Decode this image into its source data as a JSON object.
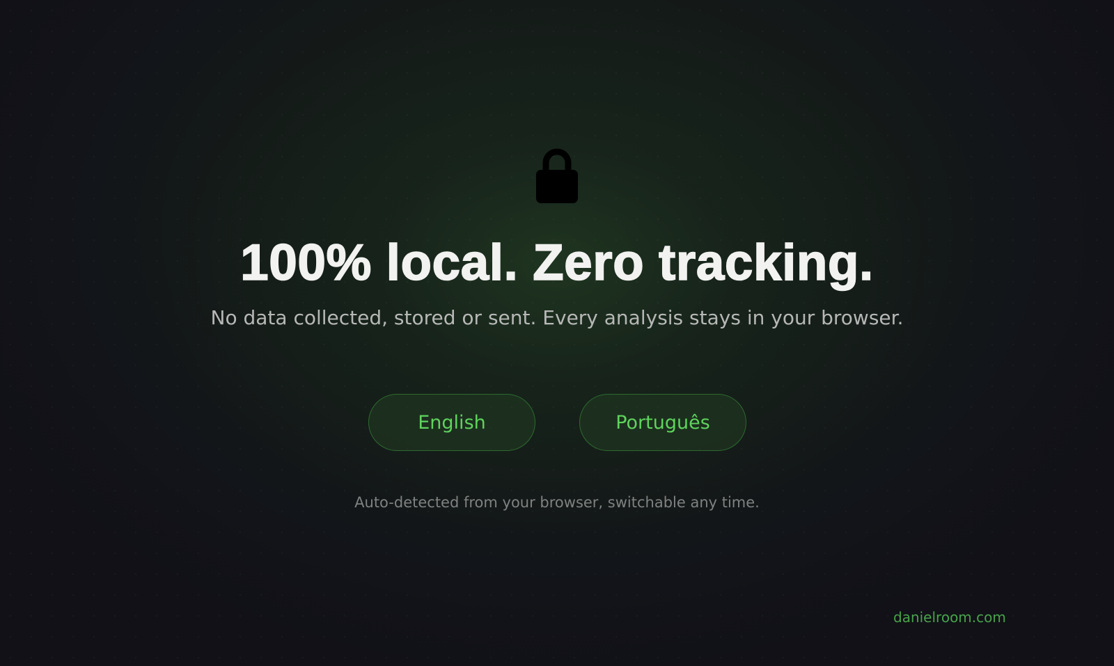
{
  "hero": {
    "icon": "lock-icon",
    "headline": "100% local. Zero tracking.",
    "subtitle": "No data collected, stored or sent. Every analysis stays in your browser."
  },
  "language_options": [
    {
      "label": "English"
    },
    {
      "label": "Português"
    }
  ],
  "note": "Auto-detected from your browser, switchable any time.",
  "footer": {
    "site_link": "danielroom.com"
  },
  "colors": {
    "background": "#111117",
    "accent_green": "#5fd35d",
    "link_green": "#48a34a",
    "headline": "#f2f2f0",
    "subtitle": "#b6b8b6",
    "note": "#7f8280"
  }
}
